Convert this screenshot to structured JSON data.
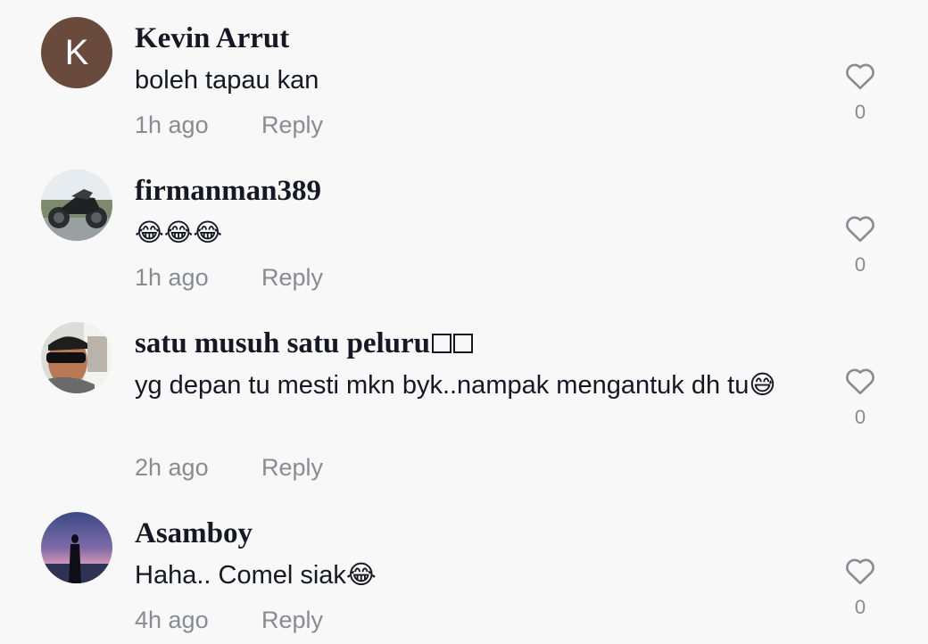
{
  "comments": [
    {
      "username": "Kevin Arrut",
      "avatar_letter": "K",
      "text": "boleh tapau kan",
      "time": "1h ago",
      "reply_label": "Reply",
      "likes": "0"
    },
    {
      "username": "firmanman389",
      "text": "😂😂😂",
      "time": "1h ago",
      "reply_label": "Reply",
      "likes": "0"
    },
    {
      "username": "satu musuh satu peluru",
      "text": "yg depan tu mesti mkn byk..nampak mengantuk dh tu😅",
      "time": "2h ago",
      "reply_label": "Reply",
      "likes": "0"
    },
    {
      "username": "Asamboy",
      "text": "Haha.. Comel siak😂",
      "time": "4h ago",
      "reply_label": "Reply",
      "likes": "0"
    }
  ],
  "colors": {
    "background": "#f8f8f8",
    "text": "#161823",
    "muted": "#8a8b91",
    "avatar_k": "#6b4a3e"
  },
  "icons": [
    "heart-outline-icon"
  ]
}
